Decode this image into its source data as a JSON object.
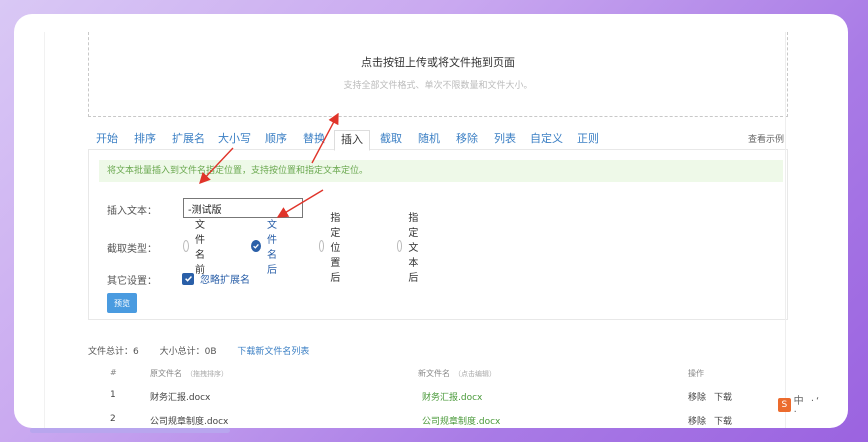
{
  "upload": {
    "title": "点击按钮上传或将文件拖到页面",
    "subtitle": "支持全部文件格式、单次不限数量和文件大小。"
  },
  "tabs": [
    {
      "label": "开始",
      "active": false
    },
    {
      "label": "排序",
      "active": false
    },
    {
      "label": "扩展名",
      "active": false
    },
    {
      "label": "大小写",
      "active": false
    },
    {
      "label": "顺序",
      "active": false
    },
    {
      "label": "替换",
      "active": false
    },
    {
      "label": "插入",
      "active": true
    },
    {
      "label": "截取",
      "active": false
    },
    {
      "label": "随机",
      "active": false
    },
    {
      "label": "移除",
      "active": false
    },
    {
      "label": "列表",
      "active": false
    },
    {
      "label": "自定义",
      "active": false
    },
    {
      "label": "正则",
      "active": false
    }
  ],
  "example_link": "查看示例",
  "panel": {
    "info": "将文本批量插入到文件名指定位置，支持按位置和指定文本定位。",
    "insert_label": "插入文本：",
    "insert_value": "-测试版",
    "type_label": "截取类型：",
    "type_options": [
      {
        "label": "文件名前",
        "checked": false
      },
      {
        "label": "文件名后",
        "checked": true
      },
      {
        "label": "指定位置后",
        "checked": false
      },
      {
        "label": "指定文本后",
        "checked": false
      }
    ],
    "other_label": "其它设置：",
    "ignore_ext_label": "忽略扩展名",
    "ignore_ext_checked": true,
    "preview_label": "预览"
  },
  "stats": {
    "total_files": "文件总计：6",
    "total_size": "大小总计：0B",
    "download_link": "下载新文件名列表"
  },
  "table": {
    "headers": {
      "index": "#",
      "original": "原文件名",
      "original_hint": "（拖拽排序）",
      "new": "新文件名",
      "new_hint": "（点击编辑）",
      "ops": "操作"
    },
    "rows": [
      {
        "index": "1",
        "original": "财务汇报.docx",
        "new": "财务汇报.docx",
        "ops": [
          "移除",
          "下载"
        ]
      },
      {
        "index": "2",
        "original": "公司规章制度.docx",
        "new": "公司规章制度.docx",
        "ops": [
          "移除",
          "下载"
        ]
      }
    ]
  },
  "logo_text": "中 ·‘ ·",
  "colors": {
    "accent": "#2a5fa8",
    "link": "#3b7fc4",
    "success_bg": "#eef9e8",
    "success_text": "#6aa84f",
    "arrow": "#e0342a",
    "button": "#4a9be0"
  }
}
